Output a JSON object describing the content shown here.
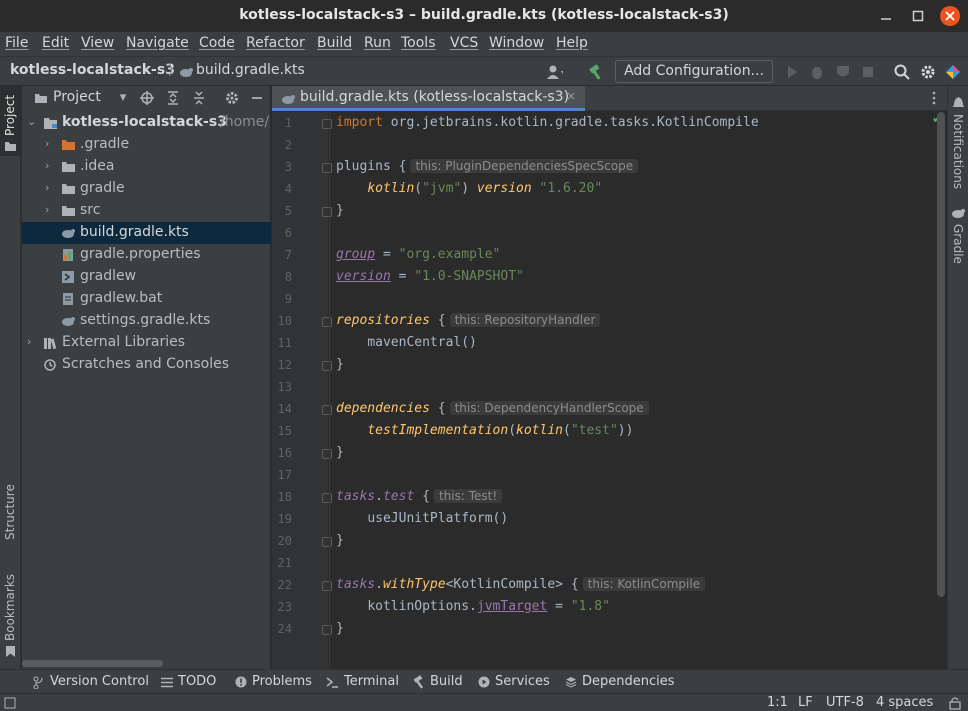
{
  "window": {
    "title": "kotless-localstack-s3 – build.gradle.kts (kotless-localstack-s3)",
    "controls": [
      "minimize",
      "maximize",
      "close"
    ]
  },
  "menu": [
    "File",
    "Edit",
    "View",
    "Navigate",
    "Code",
    "Refactor",
    "Build",
    "Run",
    "Tools",
    "VCS",
    "Window",
    "Help"
  ],
  "navbar": {
    "project": "kotless-localstack-s3",
    "file": "build.gradle.kts",
    "add_configuration": "Add Configuration..."
  },
  "left_strip": {
    "project_tab": "Project",
    "structure_tab": "Structure",
    "bookmarks_tab": "Bookmarks"
  },
  "right_strip": {
    "notifications_tab": "Notifications",
    "gradle_tab": "Gradle"
  },
  "project_panel": {
    "title": "Project",
    "tree": [
      {
        "label": "kotless-localstack-s3",
        "suffix": "/home/",
        "icon": "folder-module-icon",
        "expanded": true
      },
      {
        "label": ".gradle",
        "icon": "folder-orange-icon"
      },
      {
        "label": ".idea",
        "icon": "folder-icon"
      },
      {
        "label": "gradle",
        "icon": "folder-icon"
      },
      {
        "label": "src",
        "icon": "folder-icon"
      },
      {
        "label": "build.gradle.kts",
        "icon": "gradle-kts-icon",
        "selected": true
      },
      {
        "label": "gradle.properties",
        "icon": "properties-icon"
      },
      {
        "label": "gradlew",
        "icon": "shell-icon"
      },
      {
        "label": "gradlew.bat",
        "icon": "bat-icon"
      },
      {
        "label": "settings.gradle.kts",
        "icon": "gradle-kts-icon"
      },
      {
        "label": "External Libraries",
        "icon": "library-icon"
      },
      {
        "label": "Scratches and Consoles",
        "icon": "scratches-icon"
      }
    ]
  },
  "editor": {
    "tab_label": "build.gradle.kts (kotless-localstack-s3)",
    "line_numbers": [
      "1",
      "2",
      "3",
      "4",
      "5",
      "6",
      "7",
      "8",
      "9",
      "10",
      "11",
      "12",
      "13",
      "14",
      "15",
      "16",
      "17",
      "18",
      "19",
      "20",
      "21",
      "22",
      "23",
      "24"
    ],
    "lines": {
      "l1_import": "import",
      "l1_pkg": " org.jetbrains.kotlin.gradle.tasks.KotlinCompile",
      "l3_plugins": "plugins {",
      "l3_hint": "this: PluginDependenciesSpecScope",
      "l4_kotlin": "kotlin",
      "l4_arg": "\"jvm\"",
      "l4_version": "version",
      "l4_ver": "\"1.6.20\"",
      "l5": "}",
      "l7_group": "group",
      "l7_eq": " = ",
      "l7_val": "\"org.example\"",
      "l8_version": "version",
      "l8_eq": " = ",
      "l8_val": "\"1.0-SNAPSHOT\"",
      "l10_repos": "repositories",
      "l10_brace": " {",
      "l10_hint": "this: RepositoryHandler",
      "l11": "mavenCentral()",
      "l12": "}",
      "l14_deps": "dependencies",
      "l14_brace": " {",
      "l14_hint": "this: DependencyHandlerScope",
      "l15_test": "testImplementation",
      "l15_kotlin": "kotlin",
      "l15_arg": "\"test\"",
      "l16": "}",
      "l18_tasks": "tasks",
      "l18_test": "test",
      "l18_brace": " {",
      "l18_hint": "this: Test!",
      "l19": "useJUnitPlatform()",
      "l20": "}",
      "l22_tasks": "tasks",
      "l22_with": "withType",
      "l22_generic": "<KotlinCompile>",
      "l22_brace": " {",
      "l22_hint": "this: KotlinCompile",
      "l23_opts": "kotlinOptions.",
      "l23_jvm": "jvmTarget",
      "l23_eq": " = ",
      "l23_val": "\"1.8\"",
      "l24": "}"
    }
  },
  "tool_windows": [
    "Version Control",
    "TODO",
    "Problems",
    "Terminal",
    "Build",
    "Services",
    "Dependencies"
  ],
  "status": {
    "position": "1:1",
    "line_sep": "LF",
    "encoding": "UTF-8",
    "indent": "4 spaces"
  },
  "colors": {
    "accent": "#4a88c7",
    "selection": "#0d293e",
    "keyword": "#cc7832",
    "string": "#6a8759",
    "function": "#ffc66d",
    "property": "#9876aa"
  }
}
